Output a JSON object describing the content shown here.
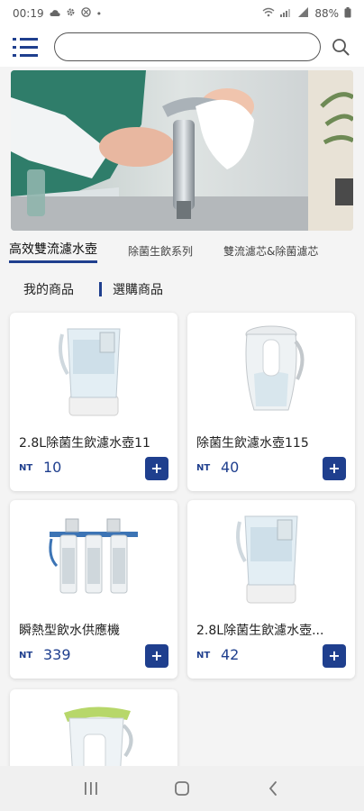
{
  "status_bar": {
    "time": "00:19",
    "icons_left": [
      "cloud-icon",
      "gear-icon",
      "alert-icon"
    ],
    "battery": "88%"
  },
  "header": {
    "search_placeholder": ""
  },
  "category_tabs": [
    {
      "label": "高效雙流濾水壺",
      "active": true
    },
    {
      "label": "除菌生飲系列",
      "active": false
    },
    {
      "label": "雙流濾芯&除菌濾芯",
      "active": false
    }
  ],
  "sub_tabs": [
    {
      "label": "我的商品"
    },
    {
      "label": "選購商品"
    }
  ],
  "products": [
    {
      "name": "2.8L除菌生飲濾水壺11",
      "currency": "NT",
      "price": "10"
    },
    {
      "name": "除菌生飲濾水壺115",
      "currency": "NT",
      "price": "40"
    },
    {
      "name": "瞬熱型飲水供應機",
      "currency": "NT",
      "price": "339"
    },
    {
      "name": "2.8L除菌生飲濾水壺...",
      "currency": "NT",
      "price": "42"
    }
  ],
  "colors": {
    "accent": "#1f3f8e",
    "background": "#f4f4f4"
  },
  "add_label": "+"
}
